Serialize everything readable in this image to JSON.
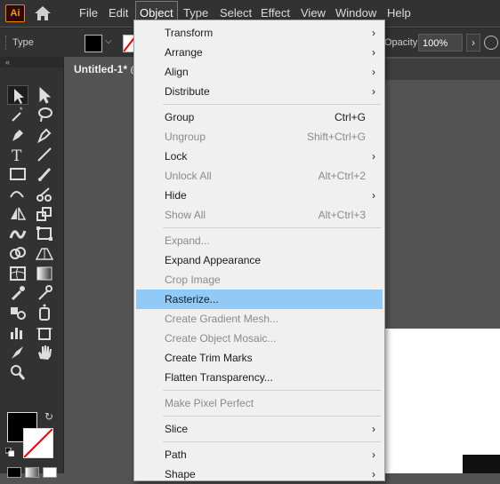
{
  "app": {
    "logo_text": "Ai"
  },
  "menubar": {
    "items": [
      "File",
      "Edit",
      "Object",
      "Type",
      "Select",
      "Effect",
      "View",
      "Window",
      "Help"
    ],
    "active": "Object"
  },
  "controlbar": {
    "selection_label": "Type",
    "opacity_label": "Opacity:",
    "opacity_value": "100%"
  },
  "document": {
    "tab_title": "Untitled-1* @"
  },
  "object_menu": {
    "items": [
      {
        "label": "Transform",
        "shortcut": "",
        "submenu": true,
        "disabled": false
      },
      {
        "label": "Arrange",
        "shortcut": "",
        "submenu": true,
        "disabled": false
      },
      {
        "label": "Align",
        "shortcut": "",
        "submenu": true,
        "disabled": false
      },
      {
        "label": "Distribute",
        "shortcut": "",
        "submenu": true,
        "disabled": false
      },
      {
        "label": "Group",
        "shortcut": "Ctrl+G",
        "submenu": false,
        "disabled": false
      },
      {
        "label": "Ungroup",
        "shortcut": "Shift+Ctrl+G",
        "submenu": false,
        "disabled": true
      },
      {
        "label": "Lock",
        "shortcut": "",
        "submenu": true,
        "disabled": false
      },
      {
        "label": "Unlock All",
        "shortcut": "Alt+Ctrl+2",
        "submenu": false,
        "disabled": true
      },
      {
        "label": "Hide",
        "shortcut": "",
        "submenu": true,
        "disabled": false
      },
      {
        "label": "Show All",
        "shortcut": "Alt+Ctrl+3",
        "submenu": false,
        "disabled": true
      },
      {
        "label": "Expand...",
        "shortcut": "",
        "submenu": false,
        "disabled": true
      },
      {
        "label": "Expand Appearance",
        "shortcut": "",
        "submenu": false,
        "disabled": false
      },
      {
        "label": "Crop Image",
        "shortcut": "",
        "submenu": false,
        "disabled": true
      },
      {
        "label": "Rasterize...",
        "shortcut": "",
        "submenu": false,
        "disabled": false,
        "highlighted": true
      },
      {
        "label": "Create Gradient Mesh...",
        "shortcut": "",
        "submenu": false,
        "disabled": true
      },
      {
        "label": "Create Object Mosaic...",
        "shortcut": "",
        "submenu": false,
        "disabled": true
      },
      {
        "label": "Create Trim Marks",
        "shortcut": "",
        "submenu": false,
        "disabled": false
      },
      {
        "label": "Flatten Transparency...",
        "shortcut": "",
        "submenu": false,
        "disabled": false
      },
      {
        "label": "Make Pixel Perfect",
        "shortcut": "",
        "submenu": false,
        "disabled": true
      },
      {
        "label": "Slice",
        "shortcut": "",
        "submenu": true,
        "disabled": false
      },
      {
        "label": "Path",
        "shortcut": "",
        "submenu": true,
        "disabled": false
      },
      {
        "label": "Shape",
        "shortcut": "",
        "submenu": true,
        "disabled": false
      }
    ]
  },
  "colors": {
    "menu_highlight": "#91c9f7",
    "menubar_bg": "#323232",
    "canvas_bg": "#535353",
    "logo_orange": "#ff7c00"
  },
  "tools": [
    [
      "selection-tool-icon",
      "direct-selection-tool-icon"
    ],
    [
      "magic-wand-tool-icon",
      "lasso-tool-icon"
    ],
    [
      "pen-tool-icon",
      "curvature-tool-icon"
    ],
    [
      "type-tool-icon",
      "line-segment-tool-icon"
    ],
    [
      "rectangle-tool-icon",
      "paintbrush-tool-icon"
    ],
    [
      "shaper-tool-icon",
      "scissors-tool-icon"
    ],
    [
      "reflect-tool-icon",
      "scale-tool-icon"
    ],
    [
      "warp-tool-icon",
      "free-transform-tool-icon"
    ],
    [
      "shape-builder-tool-icon",
      "perspective-grid-tool-icon"
    ],
    [
      "mesh-tool-icon",
      "gradient-tool-icon"
    ],
    [
      "eyedropper-tool-icon",
      "eyedropper-alt-tool-icon"
    ],
    [
      "blend-tool-icon",
      "symbol-sprayer-tool-icon"
    ],
    [
      "column-graph-tool-icon",
      "artboard-tool-icon"
    ],
    [
      "slice-tool-icon",
      "hand-tool-icon"
    ],
    [
      "zoom-tool-icon",
      ""
    ]
  ]
}
